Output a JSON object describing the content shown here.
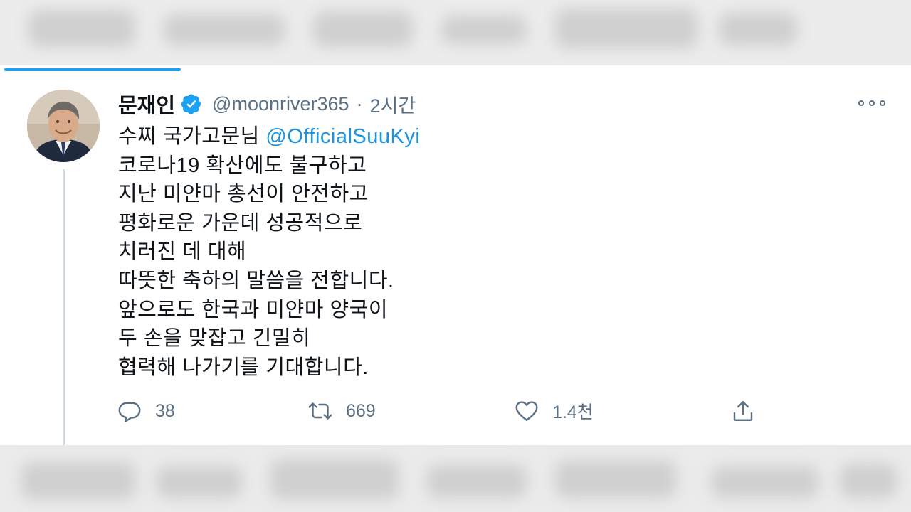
{
  "tweet": {
    "author_name": "문재인",
    "handle": "@moonriver365",
    "separator": "·",
    "time": "2시간",
    "lines": [
      {
        "before": "수찌 국가고문님 ",
        "mention": "@OfficialSuuKyi"
      },
      {
        "text": "코로나19 확산에도 불구하고"
      },
      {
        "text": "지난 미얀마 총선이 안전하고"
      },
      {
        "text": "평화로운 가운데 성공적으로"
      },
      {
        "text": "치러진 데 대해"
      },
      {
        "text": "따뜻한 축하의 말씀을 전합니다."
      },
      {
        "text": "앞으로도 한국과 미얀마 양국이"
      },
      {
        "text": "두 손을 맞잡고 긴밀히"
      },
      {
        "text": "협력해 나가기를 기대합니다."
      }
    ],
    "actions": {
      "reply_count": "38",
      "retweet_count": "669",
      "like_count": "1.4천"
    }
  },
  "icons": {
    "verified": "verified-badge-icon",
    "more": "more-horizontal-icon",
    "reply": "reply-icon",
    "retweet": "retweet-icon",
    "like": "heart-icon",
    "share": "share-icon"
  },
  "colors": {
    "accent": "#1da1f2",
    "mention": "#1b95e0",
    "secondary_text": "#5b7083",
    "primary_text": "#0f1419"
  }
}
